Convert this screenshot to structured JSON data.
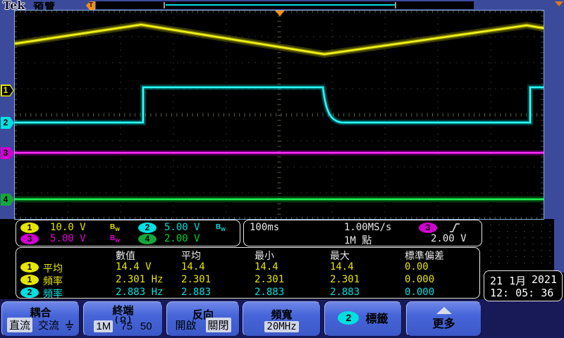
{
  "header": {
    "brand": "Tek",
    "mode": "預覽",
    "trigger_flag": "T"
  },
  "bw_badge": {
    "b": "B",
    "w": "W"
  },
  "channels": [
    {
      "id": "1",
      "scale": "10.0 V",
      "color": "#e6e600",
      "bandwidth_limited": true
    },
    {
      "id": "2",
      "scale": "5.00 V",
      "color": "#00e0e0",
      "bandwidth_limited": true
    },
    {
      "id": "3",
      "scale": "5.00 V",
      "color": "#e000e0",
      "bandwidth_limited": true
    },
    {
      "id": "4",
      "scale": "2.00 V",
      "color": "#00d435",
      "bandwidth_limited": false
    }
  ],
  "horizontal": {
    "time_per_div": "100ms",
    "sample_rate": "1.00MS/s",
    "record_length": "1M 點"
  },
  "trigger": {
    "source": "3",
    "level": "2.00 V",
    "slope": "rising"
  },
  "waveforms": {
    "ch1": "triangle wave",
    "ch2": "pulse with exponential falling edge",
    "ch3": "flat dc line",
    "ch4": "flat dc line"
  },
  "measurements": {
    "headers": {
      "value": "數值",
      "mean": "平均",
      "min": "最小",
      "max": "最大",
      "stddev": "標準偏差"
    },
    "rows": [
      {
        "ch": "1",
        "name": "平均",
        "value": "14.4 V",
        "mean": "14.4",
        "min": "14.4",
        "max": "14.4",
        "stddev": "0.00"
      },
      {
        "ch": "1",
        "name": "頻率",
        "value": "2.301 Hz",
        "mean": "2.301",
        "min": "2.301",
        "max": "2.301",
        "stddev": "0.000"
      },
      {
        "ch": "2",
        "name": "頻率",
        "value": "2.883 Hz",
        "mean": "2.883",
        "min": "2.883",
        "max": "2.883",
        "stddev": "0.000"
      }
    ]
  },
  "datetime": {
    "date": "21 1月",
    "year": "2021",
    "time": "12: 05: 36"
  },
  "menu": {
    "coupling": {
      "title": "耦合",
      "options": [
        "直流",
        "交流"
      ],
      "selected": "直流"
    },
    "termination": {
      "title": "終端",
      "subtitle": "( Ω )",
      "options": [
        "1M",
        "75",
        "50"
      ],
      "selected": "1M"
    },
    "invert": {
      "title": "反向",
      "options": [
        "開啟",
        "關閉"
      ],
      "selected": "關閉"
    },
    "bandwidth": {
      "title": "頻寬",
      "value": "20MHz"
    },
    "label": {
      "ch": "2",
      "title": "標籤"
    },
    "more": {
      "title": "更多"
    }
  },
  "colors": {
    "chassis_blue": "#3c4a9c",
    "menu_navy": "#181a58",
    "trigger_orange": "#f09018"
  }
}
